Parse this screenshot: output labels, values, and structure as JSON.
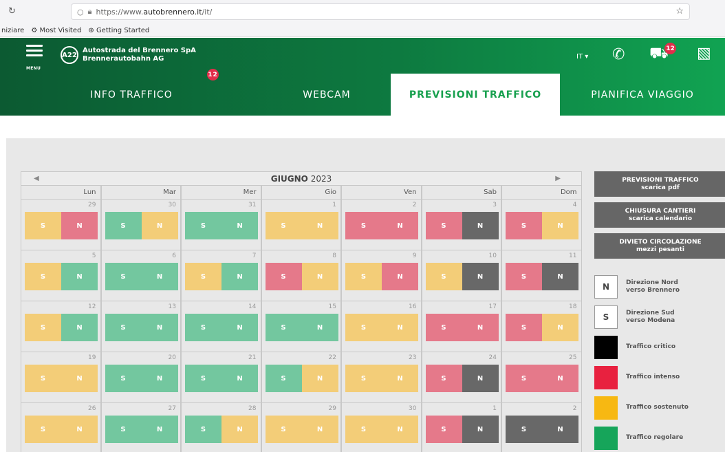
{
  "browser": {
    "url_prefix": "https://www.",
    "url_domain": "autobrennero.it",
    "url_path": "/it/",
    "bookmarks": [
      "niziare",
      "Most Visited",
      "Getting Started"
    ]
  },
  "header": {
    "menu_label": "MENU",
    "logo_text": "A22",
    "brand_line1": "Autostrada del Brennero SpA",
    "brand_line2": "Brennerautobahn AG",
    "lang": "IT ▾",
    "car_badge": "12",
    "tabs": [
      {
        "label": "INFO TRAFFICO",
        "badge": "12"
      },
      {
        "label": "WEBCAM"
      },
      {
        "label": "PREVISIONI TRAFFICO"
      },
      {
        "label": "PIANIFICA VIAGGIO"
      }
    ]
  },
  "calendar": {
    "month": "GIUGNO",
    "year": "2023",
    "weekdays": [
      "Lun",
      "Mar",
      "Mer",
      "Gio",
      "Ven",
      "Sab",
      "Dom"
    ],
    "colors": {
      "Y": "#f3cd78",
      "R": "#e5798a",
      "G": "#73c79f",
      "D": "#686868"
    },
    "weeks": [
      [
        [
          "29",
          "Y",
          "R"
        ],
        [
          "30",
          "G",
          "Y"
        ],
        [
          "31",
          "G",
          "G"
        ],
        [
          "1",
          "Y",
          "Y"
        ],
        [
          "2",
          "R",
          "R"
        ],
        [
          "3",
          "R",
          "D"
        ],
        [
          "4",
          "R",
          "Y"
        ]
      ],
      [
        [
          "5",
          "Y",
          "G"
        ],
        [
          "6",
          "G",
          "G"
        ],
        [
          "7",
          "Y",
          "G"
        ],
        [
          "8",
          "R",
          "Y"
        ],
        [
          "9",
          "Y",
          "R"
        ],
        [
          "10",
          "Y",
          "D"
        ],
        [
          "11",
          "R",
          "D"
        ]
      ],
      [
        [
          "12",
          "Y",
          "G"
        ],
        [
          "13",
          "G",
          "G"
        ],
        [
          "14",
          "G",
          "G"
        ],
        [
          "15",
          "G",
          "G"
        ],
        [
          "16",
          "Y",
          "Y"
        ],
        [
          "17",
          "R",
          "R"
        ],
        [
          "18",
          "R",
          "Y"
        ]
      ],
      [
        [
          "19",
          "Y",
          "Y"
        ],
        [
          "20",
          "G",
          "G"
        ],
        [
          "21",
          "G",
          "G"
        ],
        [
          "22",
          "G",
          "Y"
        ],
        [
          "23",
          "Y",
          "Y"
        ],
        [
          "24",
          "R",
          "D"
        ],
        [
          "25",
          "R",
          "R"
        ]
      ],
      [
        [
          "26",
          "Y",
          "Y"
        ],
        [
          "27",
          "G",
          "G"
        ],
        [
          "28",
          "G",
          "Y"
        ],
        [
          "29",
          "Y",
          "Y"
        ],
        [
          "30",
          "Y",
          "Y"
        ],
        [
          "1",
          "R",
          "D"
        ],
        [
          "2",
          "D",
          "D"
        ]
      ]
    ],
    "s_label": "S",
    "n_label": "N"
  },
  "side": {
    "buttons": [
      {
        "line1": "PREVISIONI TRAFFICO",
        "line2": "scarica pdf"
      },
      {
        "line1": "CHIUSURA CANTIERI",
        "line2": "scarica calendario"
      },
      {
        "line1": "DIVIETO CIRCOLAZIONE",
        "line2": "mezzi pesanti"
      }
    ],
    "legend": [
      {
        "box": "N",
        "color": "#ffffff",
        "line1": "Direzione Nord",
        "line2": "verso Brennero"
      },
      {
        "box": "S",
        "color": "#ffffff",
        "line1": "Direzione Sud",
        "line2": "verso Modena"
      },
      {
        "box": "",
        "color": "#000000",
        "line1": "Traffico critico",
        "line2": ""
      },
      {
        "box": "",
        "color": "#e8213f",
        "line1": "Traffico intenso",
        "line2": ""
      },
      {
        "box": "",
        "color": "#f7b812",
        "line1": "Traffico sostenuto",
        "line2": ""
      },
      {
        "box": "",
        "color": "#16a55a",
        "line1": "Traffico regolare",
        "line2": ""
      }
    ]
  }
}
